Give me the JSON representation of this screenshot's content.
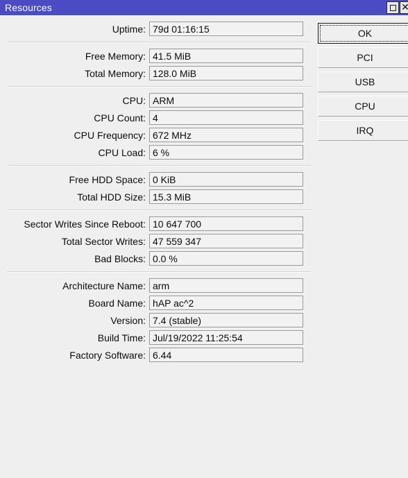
{
  "window": {
    "title": "Resources",
    "titlebar_color": "#4b4bc4",
    "background_color": "#efefef",
    "controls": {
      "restore_label": "restore",
      "close_label": "close"
    }
  },
  "groups": [
    {
      "name": "uptime",
      "rows": [
        {
          "label": "Uptime:",
          "value": "79d 01:16:15"
        }
      ]
    },
    {
      "name": "memory",
      "rows": [
        {
          "label": "Free Memory:",
          "value": "41.5 MiB"
        },
        {
          "label": "Total Memory:",
          "value": "128.0 MiB"
        }
      ]
    },
    {
      "name": "cpu",
      "rows": [
        {
          "label": "CPU:",
          "value": "ARM"
        },
        {
          "label": "CPU Count:",
          "value": "4"
        },
        {
          "label": "CPU Frequency:",
          "value": "672 MHz"
        },
        {
          "label": "CPU Load:",
          "value": "6 %"
        }
      ]
    },
    {
      "name": "hdd",
      "rows": [
        {
          "label": "Free HDD Space:",
          "value": "0 KiB"
        },
        {
          "label": "Total HDD Size:",
          "value": "15.3 MiB"
        }
      ]
    },
    {
      "name": "sector-writes",
      "rows": [
        {
          "label": "Sector Writes Since Reboot:",
          "value": "10 647 700"
        },
        {
          "label": "Total Sector Writes:",
          "value": "47 559 347"
        },
        {
          "label": "Bad Blocks:",
          "value": "0.0 %"
        }
      ]
    },
    {
      "name": "system",
      "rows": [
        {
          "label": "Architecture Name:",
          "value": "arm"
        },
        {
          "label": "Board Name:",
          "value": "hAP ac^2"
        },
        {
          "label": "Version:",
          "value": "7.4 (stable)"
        },
        {
          "label": "Build Time:",
          "value": "Jul/19/2022 11:25:54"
        },
        {
          "label": "Factory Software:",
          "value": "6.44"
        }
      ]
    }
  ],
  "buttons": [
    {
      "label": "OK",
      "focused": true
    },
    {
      "label": "PCI",
      "focused": false
    },
    {
      "label": "USB",
      "focused": false
    },
    {
      "label": "CPU",
      "focused": false
    },
    {
      "label": "IRQ",
      "focused": false
    }
  ]
}
